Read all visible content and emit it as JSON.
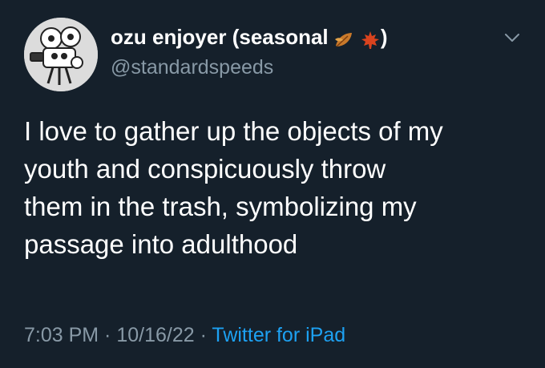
{
  "author": {
    "display_name": "ozu enjoyer (seasonal",
    "display_name_close": ")",
    "handle": "@standardspeeds",
    "emoji_icons": [
      "fallen-leaf-icon",
      "maple-leaf-icon"
    ]
  },
  "tweet": {
    "lines": [
      "I love to gather up the objects of my",
      "youth and conspicuously throw",
      "them in the trash, symbolizing my",
      "passage into adulthood"
    ]
  },
  "meta": {
    "time": "7:03 PM",
    "sep1": " · ",
    "date": "10/16/22",
    "sep2": " · ",
    "source": "Twitter for iPad"
  },
  "colors": {
    "background": "#15202b",
    "secondary_text": "#8899a6",
    "link": "#1da1f2"
  }
}
